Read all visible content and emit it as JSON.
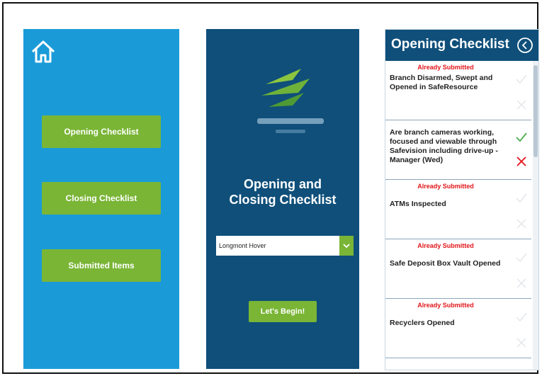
{
  "colors": {
    "menu_panel": "#1a9bd8",
    "navy_panel": "#0f4f7a",
    "button_green": "#7ab536",
    "alert_red": "#e2151a",
    "check_green": "#4caf50"
  },
  "home_panel": {
    "home_icon": "home-icon",
    "buttons": [
      {
        "label": "Opening Checklist"
      },
      {
        "label": "Closing Checklist"
      },
      {
        "label": "Submitted Items"
      }
    ]
  },
  "start_panel": {
    "logo_icon": "company-logo",
    "title": "Opening and Closing Checklist",
    "branch_select": {
      "value": "Longmont Hover"
    },
    "begin_label": "Let's Begin!"
  },
  "checklist_panel": {
    "title": "Opening Checklist",
    "back_icon": "back-arrow-icon",
    "items": [
      {
        "status": "Already Submitted",
        "text": "Branch Disarmed, Swept and Opened in SafeResource",
        "active": false
      },
      {
        "status": "",
        "text": "Are branch cameras working, focused and viewable through Safevision including drive-up - Manager (Wed)",
        "active": true
      },
      {
        "status": "Already Submitted",
        "text": "ATMs Inspected",
        "active": false
      },
      {
        "status": "Already Submitted",
        "text": "Safe Deposit Box Vault Opened",
        "active": false
      },
      {
        "status": "Already Submitted",
        "text": "Recyclers Opened",
        "active": false
      }
    ]
  }
}
